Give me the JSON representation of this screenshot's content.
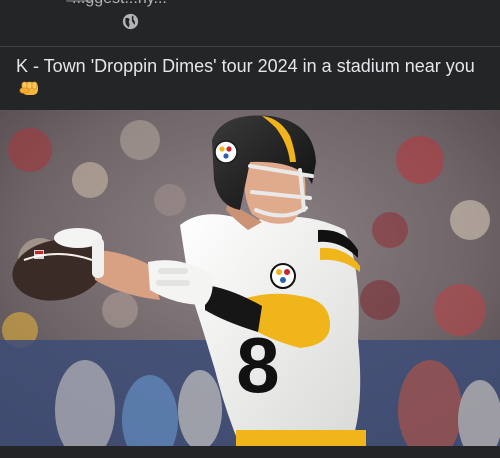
{
  "post": {
    "previous_text_fragment": "...ggest...ny...",
    "caption": "K - Town 'Droppin Dimes' tour 2024 in a stadium near you",
    "caption_emoji": "fist-bump",
    "privacy_icon": "globe-icon"
  },
  "photo": {
    "subject": "Pittsburgh Steelers quarterback passing",
    "jersey_number": "8",
    "colors": {
      "helmet": "#1c1c1c",
      "helmet_stripe": "#f1b51c",
      "jersey": "#f2f2f0",
      "sleeve": "#f1b51c",
      "ball": "#3a2b26",
      "background_crowd": "#7a6f73",
      "wall": "#3c4c77"
    }
  }
}
